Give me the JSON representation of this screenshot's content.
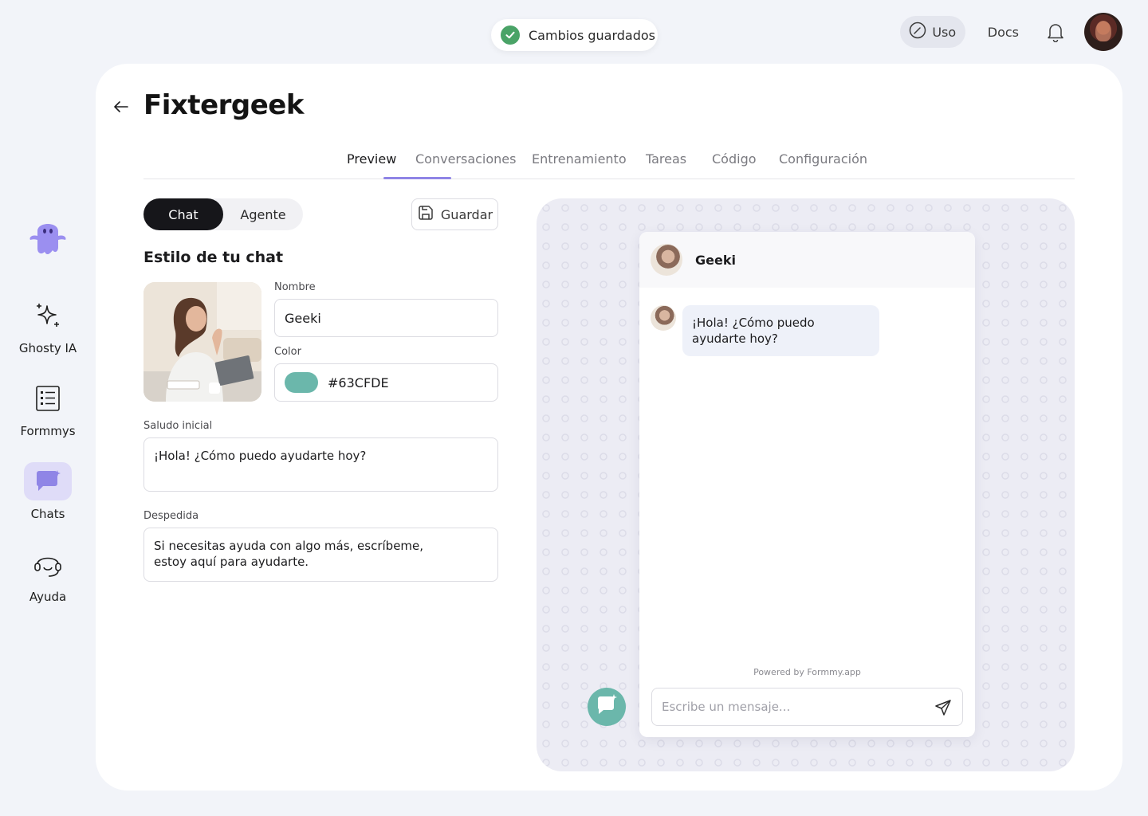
{
  "toast": {
    "text": "Cambios guardados"
  },
  "topnav": {
    "uso_label": "Uso",
    "docs_label": "Docs"
  },
  "sidebar": {
    "items": [
      {
        "label": "Ghosty IA"
      },
      {
        "label": "Formmys"
      },
      {
        "label": "Chats"
      },
      {
        "label": "Ayuda"
      }
    ]
  },
  "page": {
    "title": "Fixtergeek"
  },
  "tabs": [
    "Preview",
    "Conversaciones",
    "Entrenamiento",
    "Tareas",
    "Código",
    "Configuración"
  ],
  "mode_toggle": {
    "chat": "Chat",
    "agent": "Agente"
  },
  "save_label": "Guardar",
  "style_section": {
    "title": "Estilo de tu chat",
    "name_label": "Nombre",
    "name_value": "Geeki",
    "color_label": "Color",
    "color_value": "#63CFDE",
    "greeting_label": "Saludo inicial",
    "greeting_value": "¡Hola! ¿Cómo puedo ayudarte hoy?",
    "farewell_label": "Despedida",
    "farewell_value": "Si necesitas ayuda con algo más, escríbeme,\nestoy aquí para ayudarte."
  },
  "preview": {
    "bot_name": "Geeki",
    "greeting_bubble": "¡Hola! ¿Cómo puedo ayudarte hoy?",
    "powered_by": "Powered by Formmy.app",
    "input_placeholder": "Escribe un mensaje..."
  },
  "colors": {
    "accent": "#8f85e6",
    "chat_color": "#63CFDE",
    "success": "#4aa367"
  }
}
